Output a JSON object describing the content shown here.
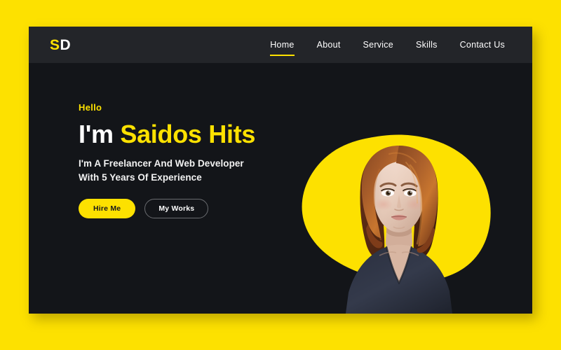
{
  "page": {
    "background_color": "#FDE100",
    "card_background": "#131519",
    "header_background": "#232529",
    "accent_color": "#FDE100"
  },
  "header": {
    "logo": {
      "first": "S",
      "second": "D",
      "first_color": "#FDE100",
      "second_color": "#FFFFFF"
    },
    "nav": [
      {
        "label": "Home",
        "active": true
      },
      {
        "label": "About",
        "active": false
      },
      {
        "label": "Service",
        "active": false
      },
      {
        "label": "Skills",
        "active": false
      },
      {
        "label": "Contact Us",
        "active": false
      }
    ]
  },
  "hero": {
    "greeting": "Hello",
    "headline_white": "I'm ",
    "headline_yellow": "Saidos Hits",
    "subhead_line1": "I'm A Freelancer And Web Developer",
    "subhead_line2": "With 5 Years Of Experience",
    "primary_button": "Hire Me",
    "secondary_button": "My Works",
    "portrait_alt": "portrait of a woman with auburn bob hair wearing a dark navy top",
    "blob_color": "#FDE100"
  }
}
